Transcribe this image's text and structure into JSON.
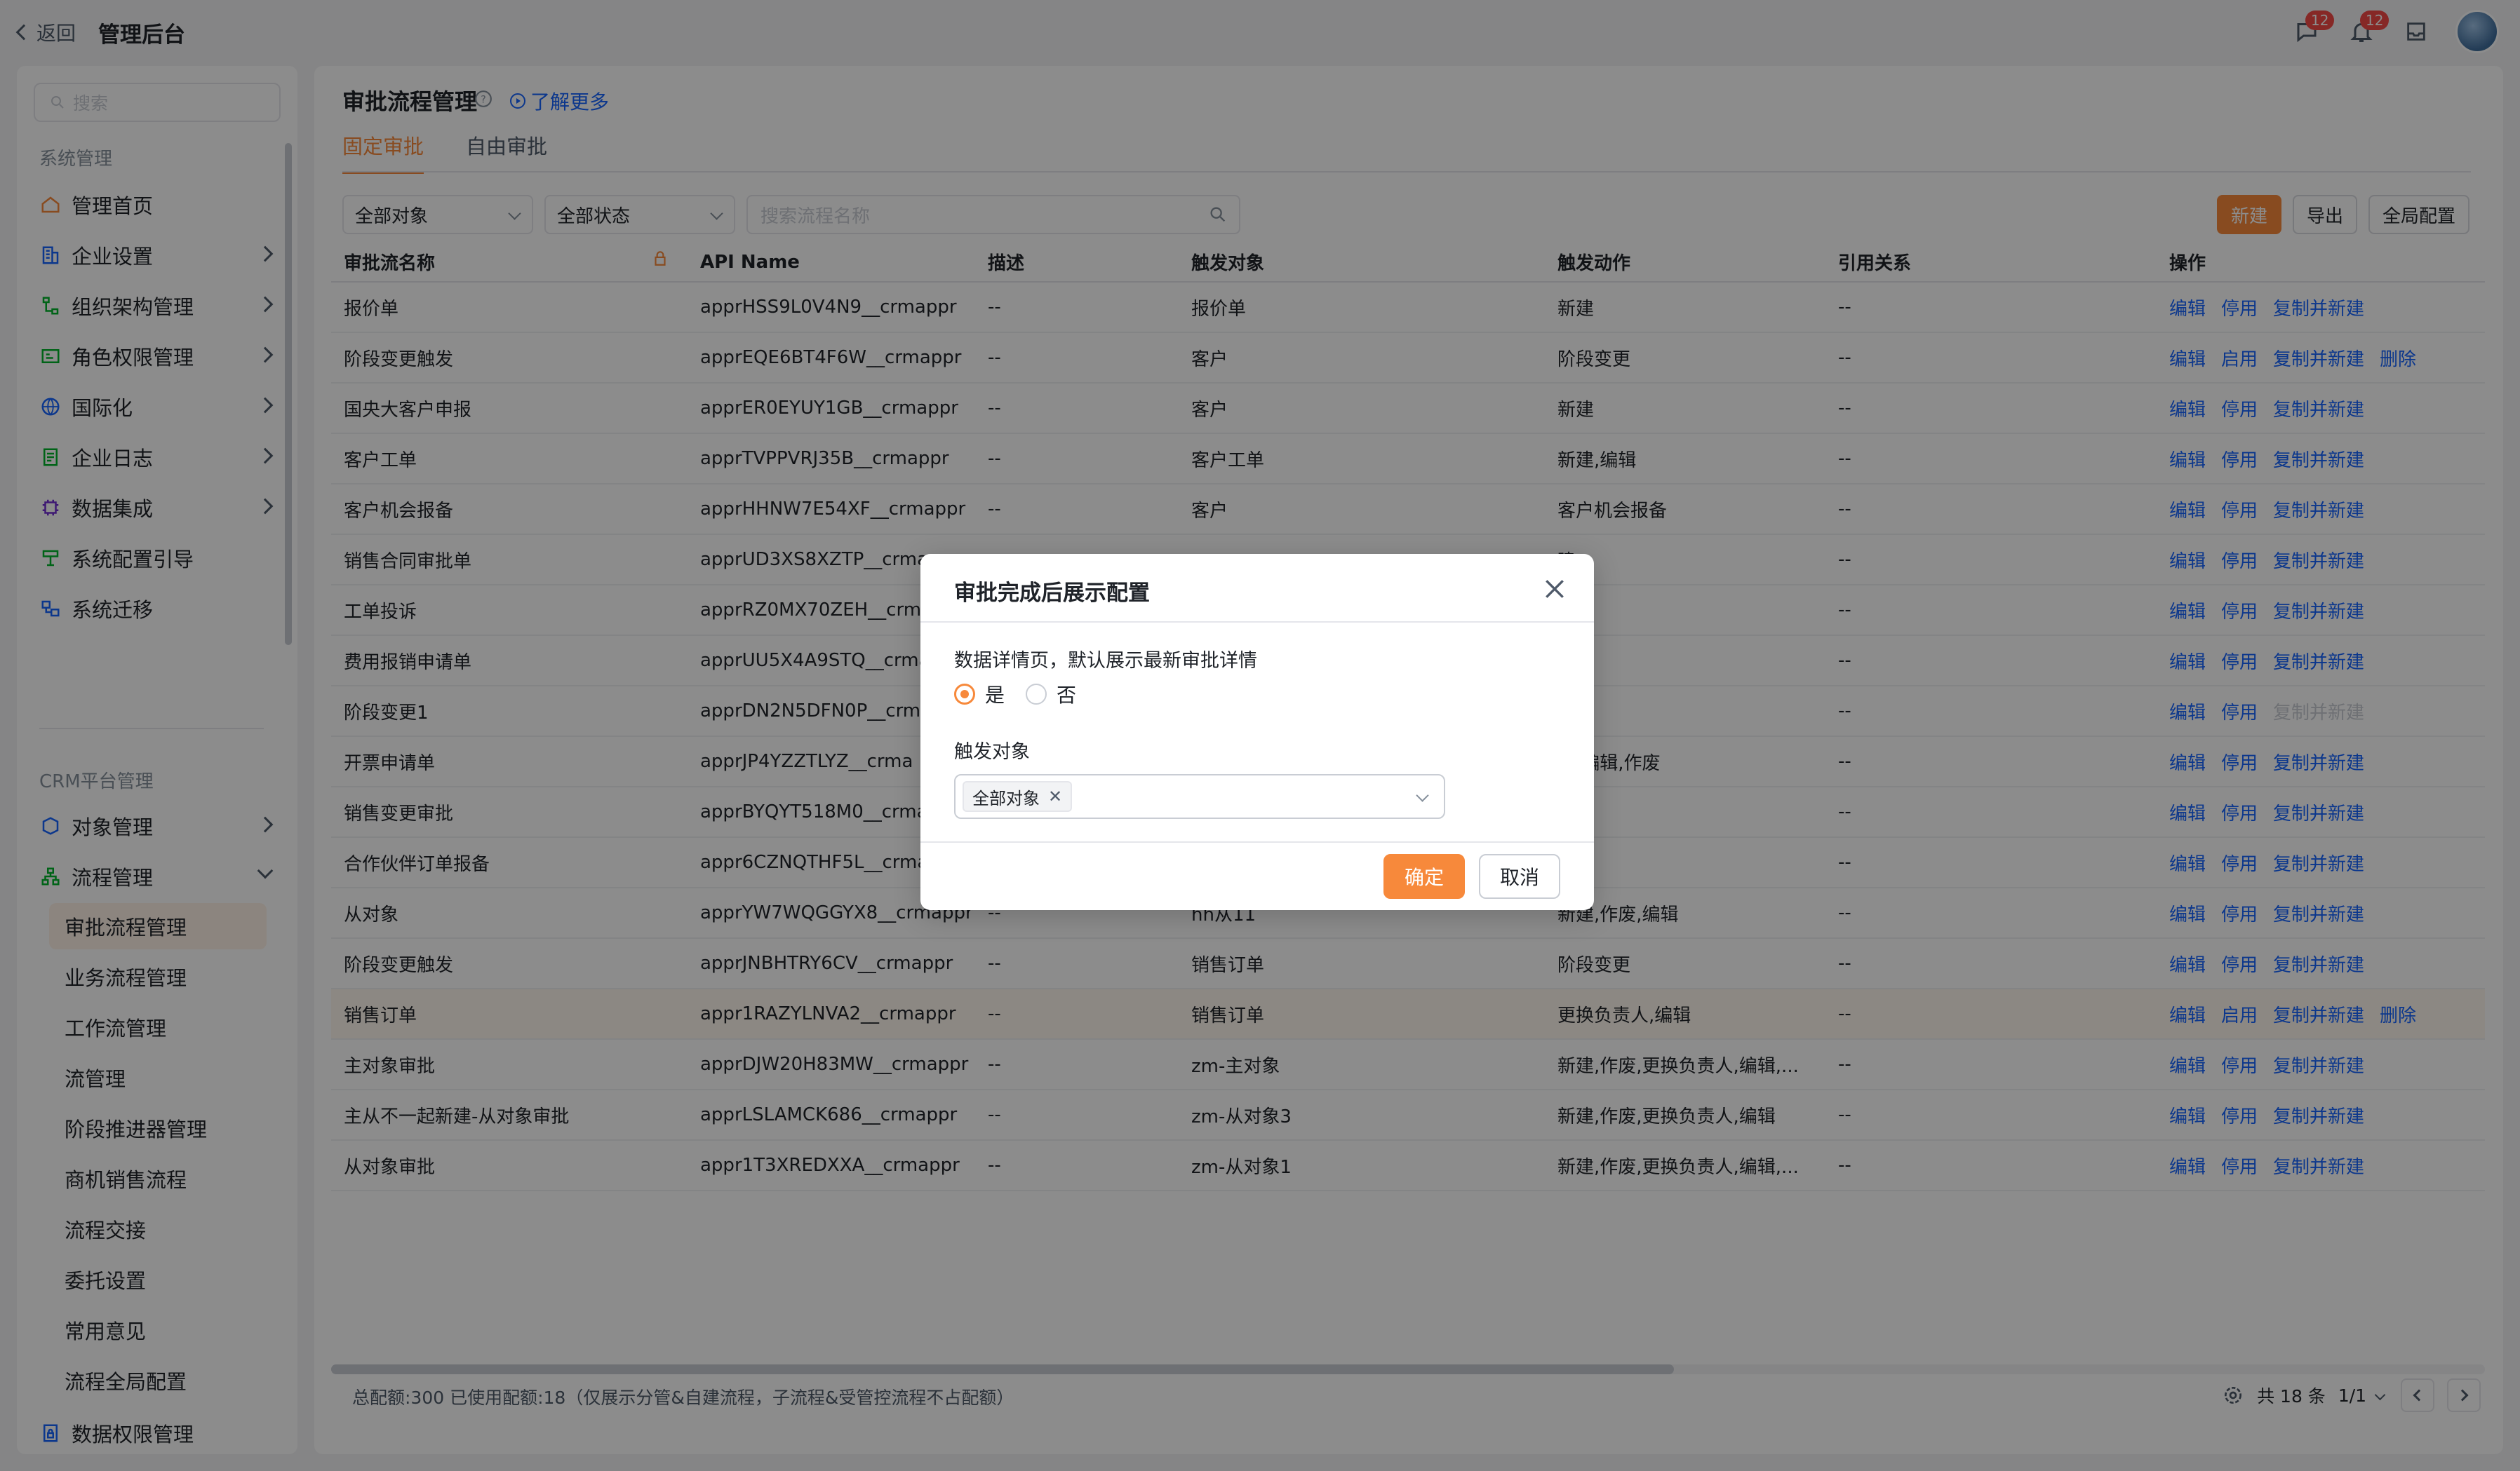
{
  "topbar": {
    "back": "返回",
    "title": "管理后台",
    "chat_badge": "12",
    "bell_badge": "12"
  },
  "sidebar": {
    "search_placeholder": "搜索",
    "section1": "系统管理",
    "items": [
      {
        "label": "管理首页",
        "icon": "home-icon"
      },
      {
        "label": "企业设置",
        "icon": "building-icon"
      },
      {
        "label": "组织架构管理",
        "icon": "org-icon"
      },
      {
        "label": "角色权限管理",
        "icon": "role-icon"
      },
      {
        "label": "国际化",
        "icon": "globe-icon"
      },
      {
        "label": "企业日志",
        "icon": "log-icon"
      },
      {
        "label": "数据集成",
        "icon": "integration-icon"
      },
      {
        "label": "系统配置引导",
        "icon": "guide-icon"
      },
      {
        "label": "系统迁移",
        "icon": "migrate-icon"
      }
    ],
    "section2": "CRM平台管理",
    "crm_items": [
      {
        "label": "对象管理",
        "icon": "object-icon"
      },
      {
        "label": "流程管理",
        "icon": "flow-icon"
      }
    ],
    "sub_items": [
      "审批流程管理",
      "业务流程管理",
      "工作流管理",
      "流管理",
      "阶段推进器管理",
      "商机销售流程",
      "流程交接",
      "委托设置",
      "常用意见",
      "流程全局配置"
    ],
    "last_item": "数据权限管理",
    "collapse": "«"
  },
  "main": {
    "title": "审批流程管理",
    "learn_more": "了解更多",
    "tabs": [
      "固定审批",
      "自由审批"
    ],
    "filter_object": "全部对象",
    "filter_status": "全部状态",
    "search_placeholder": "搜索流程名称",
    "btn_new": "新建",
    "btn_export": "导出",
    "btn_global": "全局配置",
    "columns": [
      "审批流名称",
      "API Name",
      "描述",
      "触发对象",
      "触发动作",
      "引用关系",
      "操作"
    ],
    "rows": [
      {
        "name": "报价单",
        "api": "apprHSS9L0V4N9__crmappr",
        "desc": "--",
        "obj": "报价单",
        "action": "新建",
        "ref": "--",
        "ops": [
          "编辑",
          "停用",
          "复制并新建"
        ]
      },
      {
        "name": "阶段变更触发",
        "api": "apprEQE6BT4F6W__crmappr",
        "desc": "--",
        "obj": "客户",
        "action": "阶段变更",
        "ref": "--",
        "ops": [
          "编辑",
          "启用",
          "复制并新建",
          "删除"
        ]
      },
      {
        "name": "国央大客户申报",
        "api": "apprER0EYUY1GB__crmappr",
        "desc": "--",
        "obj": "客户",
        "action": "新建",
        "ref": "--",
        "ops": [
          "编辑",
          "停用",
          "复制并新建"
        ]
      },
      {
        "name": "客户工单",
        "api": "apprTVPPVRJ35B__crmappr",
        "desc": "--",
        "obj": "客户工单",
        "action": "新建,编辑",
        "ref": "--",
        "ops": [
          "编辑",
          "停用",
          "复制并新建"
        ]
      },
      {
        "name": "客户机会报备",
        "api": "apprHHNW7E54XF__crmappr",
        "desc": "--",
        "obj": "客户",
        "action": "客户机会报备",
        "ref": "--",
        "ops": [
          "编辑",
          "停用",
          "复制并新建"
        ]
      },
      {
        "name": "销售合同审批单",
        "api": "apprUD3XS8XZTP__crma",
        "desc": "",
        "obj": "",
        "action": "建",
        "ref": "--",
        "ops": [
          "编辑",
          "停用",
          "复制并新建"
        ]
      },
      {
        "name": "工单投诉",
        "api": "apprRZ0MX70ZEH__crma",
        "desc": "",
        "obj": "",
        "action": "建",
        "ref": "--",
        "ops": [
          "编辑",
          "停用",
          "复制并新建"
        ]
      },
      {
        "name": "费用报销申请单",
        "api": "apprUU5X4A9STQ__crma",
        "desc": "",
        "obj": "",
        "action": "建",
        "ref": "--",
        "ops": [
          "编辑",
          "停用",
          "复制并新建"
        ]
      },
      {
        "name": "阶段变更1",
        "api": "apprDN2N5DFN0P__crma",
        "desc": "",
        "obj": "",
        "action": "",
        "ref": "--",
        "ops": [
          "编辑",
          "停用",
          "复制并新建"
        ]
      },
      {
        "name": "开票申请单",
        "api": "apprJP4YZZTLYZ__crma",
        "desc": "",
        "obj": "",
        "action": "建,编辑,作废",
        "ref": "--",
        "ops": [
          "编辑",
          "停用",
          "复制并新建"
        ]
      },
      {
        "name": "销售变更审批",
        "api": "apprBYQYT518M0__crma",
        "desc": "",
        "obj": "",
        "action": "建",
        "ref": "--",
        "ops": [
          "编辑",
          "停用",
          "复制并新建"
        ]
      },
      {
        "name": "合作伙伴订单报备",
        "api": "appr6CZNQTHF5L__crma",
        "desc": "",
        "obj": "",
        "action": "建",
        "ref": "--",
        "ops": [
          "编辑",
          "停用",
          "复制并新建"
        ]
      },
      {
        "name": "从对象",
        "api": "apprYW7WQGGYX8__crmappr",
        "desc": "--",
        "obj": "hh从11",
        "action": "新建,作废,编辑",
        "ref": "--",
        "ops": [
          "编辑",
          "停用",
          "复制并新建"
        ]
      },
      {
        "name": "阶段变更触发",
        "api": "apprJNBHTRY6CV__crmappr",
        "desc": "--",
        "obj": "销售订单",
        "action": "阶段变更",
        "ref": "--",
        "ops": [
          "编辑",
          "停用",
          "复制并新建"
        ]
      },
      {
        "name": "销售订单",
        "api": "appr1RAZYLNVA2__crmappr",
        "desc": "--",
        "obj": "销售订单",
        "action": "更换负责人,编辑",
        "ref": "--",
        "ops": [
          "编辑",
          "启用",
          "复制并新建",
          "删除"
        ]
      },
      {
        "name": "主对象审批",
        "api": "apprDJW20H83MW__crmappr",
        "desc": "--",
        "obj": "zm-主对象",
        "action": "新建,作废,更换负责人,编辑,...",
        "ref": "--",
        "ops": [
          "编辑",
          "停用",
          "复制并新建"
        ]
      },
      {
        "name": "主从不一起新建-从对象审批",
        "api": "apprLSLAMCK686__crmappr",
        "desc": "--",
        "obj": "zm-从对象3",
        "action": "新建,作废,更换负责人,编辑",
        "ref": "--",
        "ops": [
          "编辑",
          "停用",
          "复制并新建"
        ]
      },
      {
        "name": "从对象审批",
        "api": "appr1T3XREDXXA__crmappr",
        "desc": "--",
        "obj": "zm-从对象1",
        "action": "新建,作废,更换负责人,编辑,...",
        "ref": "--",
        "ops": [
          "编辑",
          "停用",
          "复制并新建"
        ]
      }
    ],
    "footer_note": "总配额:300 已使用配额:18（仅展示分管&自建流程，子流程&受管控流程不占配额）",
    "pager_total": "共 18 条",
    "pager_page": "1/1"
  },
  "modal": {
    "title": "审批完成后展示配置",
    "question": "数据详情页，默认展示最新审批详情",
    "yes": "是",
    "no": "否",
    "field_label": "触发对象",
    "tag": "全部对象",
    "ok": "确定",
    "cancel": "取消"
  },
  "colors": {
    "accent": "#f7893b",
    "link": "#1664ff"
  }
}
